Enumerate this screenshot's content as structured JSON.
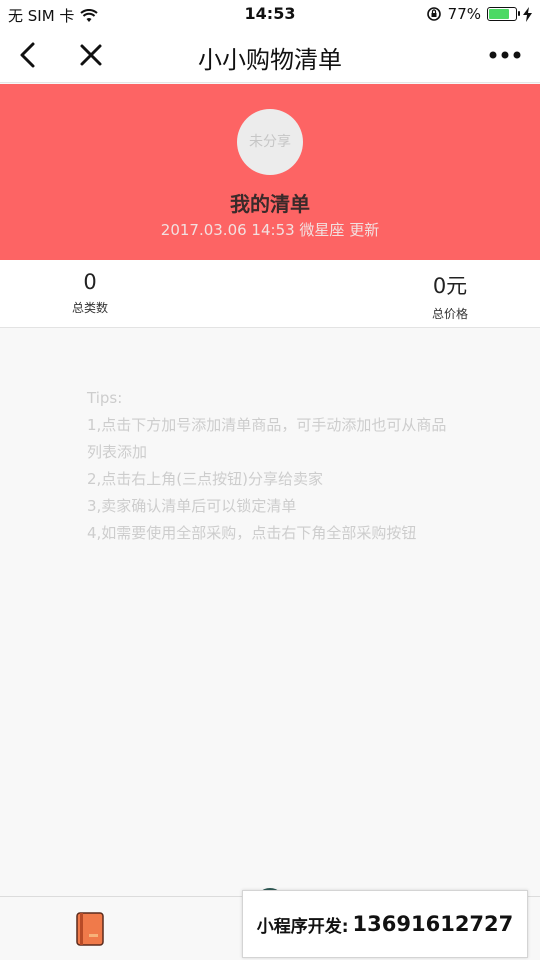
{
  "status_bar": {
    "carrier": "无 SIM 卡",
    "time": "14:53",
    "battery_percent": "77%",
    "battery_level": 0.77,
    "battery_color": "#4cd964"
  },
  "nav": {
    "title": "小小购物清单",
    "back_icon": "chevron-left-icon",
    "close_icon": "close-icon",
    "more_icon": "more-dots-icon"
  },
  "header": {
    "bg_color": "#fd6464",
    "avatar_text": "未分享",
    "title": "我的清单",
    "subtitle": "2017.03.06 14:53 微星座 更新"
  },
  "stats": {
    "count_value": "0",
    "count_label": "总类数",
    "price_value": "0元",
    "price_label": "总价格"
  },
  "tips": {
    "heading": "Tips:",
    "items": [
      "1,点击下方加号添加清单商品，可手动添加也可从商品列表添加",
      "2,点击右上角(三点按钮)分享给卖家",
      "3,卖家确认清单后可以锁定清单",
      "4,如需要使用全部采购，点击右下角全部采购按钮"
    ]
  },
  "tab_bar": {
    "book_icon": "notebook-icon"
  },
  "dev_banner": {
    "label": "小程序开发:",
    "phone": "13691612727"
  }
}
